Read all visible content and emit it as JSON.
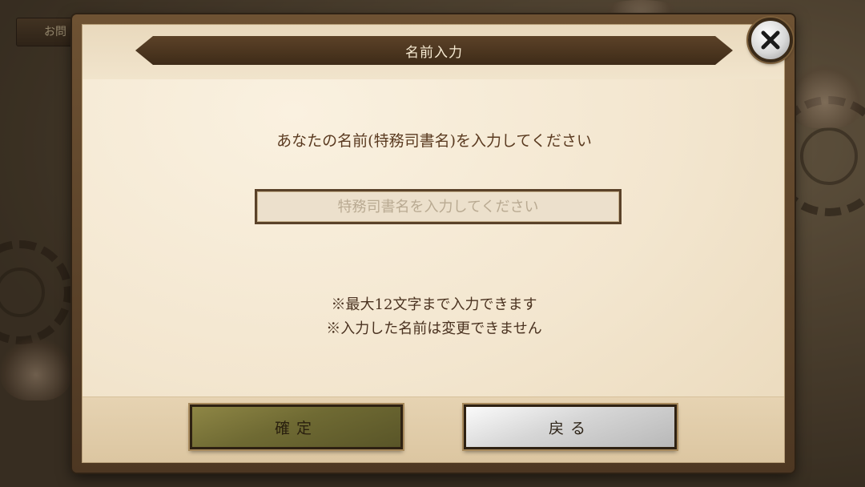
{
  "background": {
    "tab_label": "お問"
  },
  "dialog": {
    "title": "名前入力",
    "close_icon": "close-x-icon",
    "prompt": "あなたの名前(特務司書名)を入力してください",
    "name_input": {
      "value": "",
      "placeholder": "特務司書名を入力してください"
    },
    "notes": [
      "※最大12文字まで入力できます",
      "※入力した名前は変更できません"
    ],
    "buttons": {
      "confirm_label": "確定",
      "back_label": "戻る"
    }
  },
  "colors": {
    "banner": "#4a3520",
    "confirm_button": "#7a7338",
    "back_button": "#d6d6d6",
    "text": "#5a3a20"
  }
}
